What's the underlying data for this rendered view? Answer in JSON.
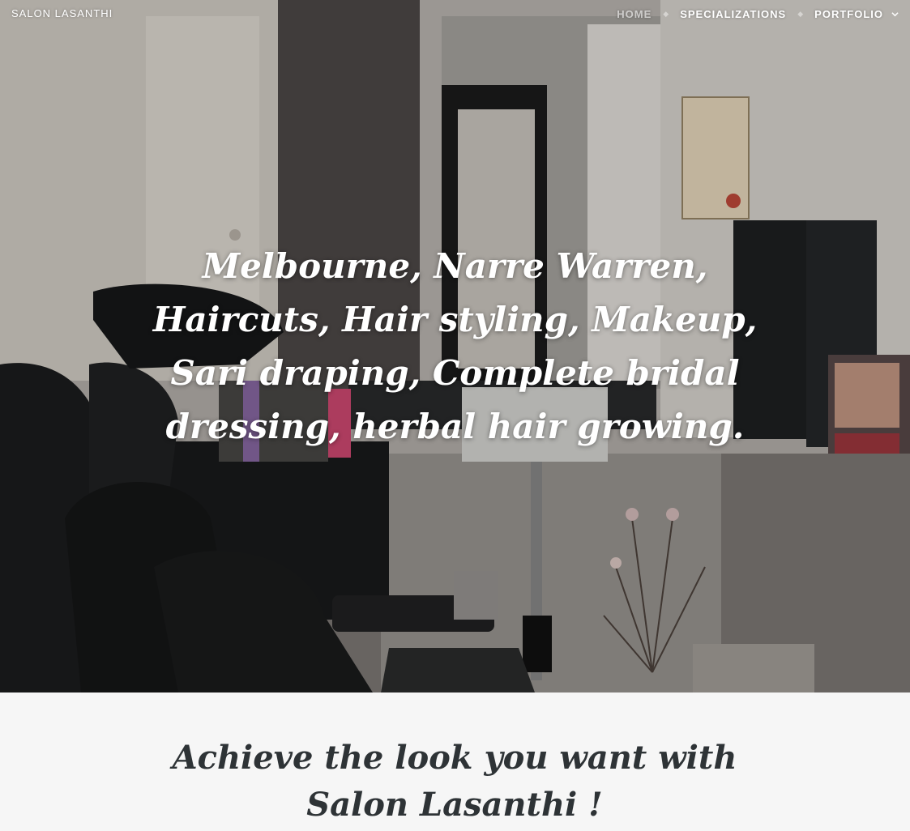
{
  "site": {
    "title": "SALON LASANTHI"
  },
  "nav": {
    "items": [
      {
        "label": "HOME",
        "active": true
      },
      {
        "label": "SPECIALIZATIONS",
        "active": false
      },
      {
        "label": "PORTFOLIO",
        "active": false,
        "has_dropdown": true
      }
    ],
    "separator_icon": "diamond-icon",
    "dropdown_icon": "chevron-down-icon"
  },
  "hero": {
    "headline": "Melbourne, Narre Warren, Haircuts, Hair styling, Makeup, Sari draping, Complete bridal dressing, herbal hair growing.",
    "image_alt": "salon-interior-photo"
  },
  "intro": {
    "heading": "Achieve the look you want with Salon Lasanthi !"
  },
  "colors": {
    "text_light": "#ffffff",
    "nav_active": "#d8d6d4",
    "intro_bg": "#f6f6f6",
    "intro_text": "#2e3336"
  }
}
